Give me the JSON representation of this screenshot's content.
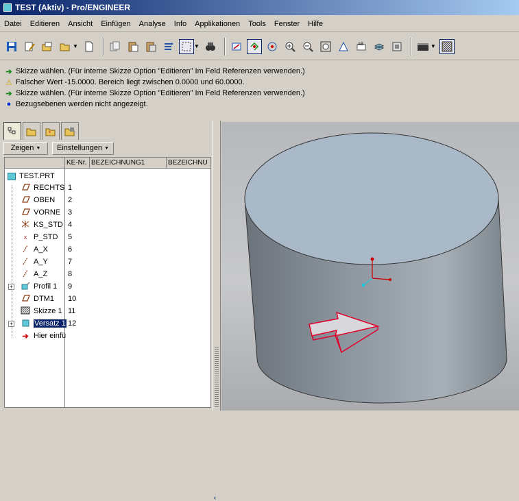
{
  "window": {
    "title": "TEST (Aktiv) - Pro/ENGINEER"
  },
  "menu": {
    "items": [
      "Datei",
      "Editieren",
      "Ansicht",
      "Einfügen",
      "Analyse",
      "Info",
      "Applikationen",
      "Tools",
      "Fenster",
      "Hilfe"
    ]
  },
  "toolbar": {
    "icons": [
      "save-icon",
      "edit-icon",
      "open-icon",
      "folder-open-icon",
      "new-file-icon",
      "copy-icon",
      "paste-icon",
      "paste-special-icon",
      "regenerate-icon",
      "selection-box-icon",
      "find-icon",
      "sketch-icon",
      "datum-point-icon",
      "spin-center-icon",
      "zoom-in-icon",
      "zoom-out-icon",
      "refit-icon",
      "reorient-icon",
      "annotation-icon",
      "layers-icon",
      "view-manager-icon",
      "shading-icon",
      "hidden-line-icon"
    ]
  },
  "messages": [
    {
      "type": "prompt",
      "text": "Skizze wählen. (Für interne Skizze Option \"Editieren\" Im Feld Referenzen verwenden.)"
    },
    {
      "type": "warning",
      "text": "Falscher Wert -15.0000. Bereich liegt zwischen 0.0000 und 60.0000."
    },
    {
      "type": "prompt",
      "text": "Skizze wählen. (Für interne Skizze Option \"Editieren\" Im Feld Referenzen verwenden.)"
    },
    {
      "type": "info",
      "text": "Bezugsebenen werden nicht angezeigt."
    }
  ],
  "panel": {
    "show_button": "Zeigen",
    "settings_button": "Einstellungen",
    "columns": [
      "",
      "KE-Nr.",
      "BEZEICHNUNG1",
      "BEZEICHNU"
    ]
  },
  "tree": {
    "root": "TEST.PRT",
    "items": [
      {
        "name": "RECHTS",
        "num": "1",
        "icon": "datum-plane-icon"
      },
      {
        "name": "OBEN",
        "num": "2",
        "icon": "datum-plane-icon"
      },
      {
        "name": "VORNE",
        "num": "3",
        "icon": "datum-plane-icon"
      },
      {
        "name": "KS_STD",
        "num": "4",
        "icon": "coordinate-system-icon"
      },
      {
        "name": "P_STD",
        "num": "5",
        "icon": "datum-point-icon"
      },
      {
        "name": "A_X",
        "num": "6",
        "icon": "datum-axis-icon"
      },
      {
        "name": "A_Y",
        "num": "7",
        "icon": "datum-axis-icon"
      },
      {
        "name": "A_Z",
        "num": "8",
        "icon": "datum-axis-icon"
      },
      {
        "name": "Profil 1",
        "num": "9",
        "icon": "extrude-icon"
      },
      {
        "name": "DTM1",
        "num": "10",
        "icon": "datum-plane-icon"
      },
      {
        "name": "Skizze 1",
        "num": "11",
        "icon": "sketch-icon"
      },
      {
        "name": "Versatz 1",
        "num": "12",
        "icon": "offset-icon"
      },
      {
        "name": "Hier einfü",
        "num": "",
        "icon": "insert-here-icon"
      }
    ]
  },
  "colors": {
    "title_start": "#0a246a",
    "title_end": "#a6caf0",
    "selection": "#0a246a",
    "model_top": "#aab9c8"
  }
}
